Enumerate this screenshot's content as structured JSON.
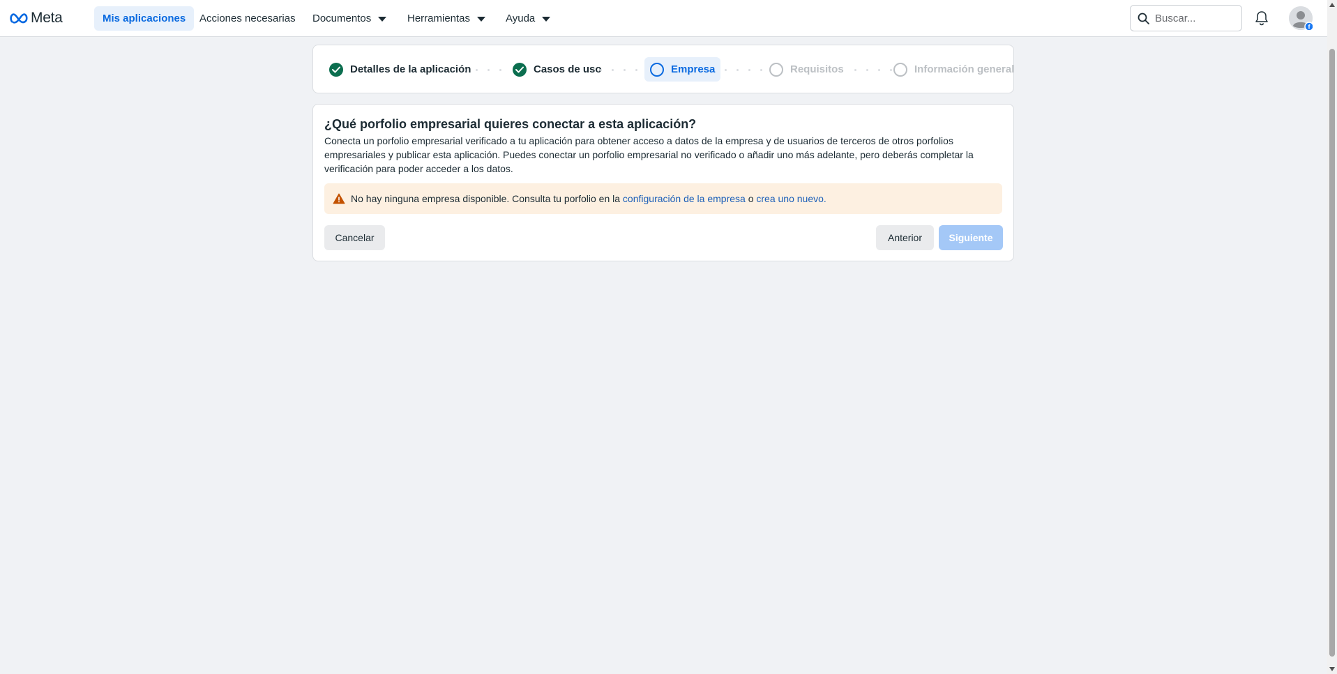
{
  "header": {
    "logo_text": "Meta",
    "nav": [
      {
        "label": "Mis aplicaciones",
        "active": true
      },
      {
        "label": "Acciones necesarias"
      },
      {
        "label": "Documentos",
        "dropdown": true
      },
      {
        "label": "Herramientas",
        "dropdown": true
      },
      {
        "label": "Ayuda",
        "dropdown": true
      }
    ],
    "search_placeholder": "Buscar..."
  },
  "stepper": {
    "steps": [
      {
        "label": "Detalles de la aplicación",
        "state": "done"
      },
      {
        "label": "Casos de uso",
        "state": "done"
      },
      {
        "label": "Empresa",
        "state": "current"
      },
      {
        "label": "Requisitos",
        "state": "future"
      },
      {
        "label": "Información general",
        "state": "future"
      }
    ]
  },
  "main": {
    "title": "¿Qué porfolio empresarial quieres conectar a esta aplicación?",
    "description": "Conecta un porfolio empresarial verificado a tu aplicación para obtener acceso a datos de la empresa y de usuarios de terceros de otros porfolios empresariales y publicar esta aplicación. Puedes conectar un porfolio empresarial no verificado o añadir uno más adelante, pero deberás completar la verificación para poder acceder a los datos.",
    "warning": {
      "text_before": "No hay ninguna empresa disponible. Consulta tu porfolio en la ",
      "link1": "configuración de la empresa",
      "text_mid": " o ",
      "link2": "crea uno nuevo."
    },
    "buttons": {
      "cancel": "Cancelar",
      "previous": "Anterior",
      "next": "Siguiente"
    }
  },
  "colors": {
    "accent": "#0a6ae0",
    "done_green": "#0b6e4f",
    "warning_bg": "#fdf0e1",
    "next_disabled": "#a4c8f7"
  },
  "icons": [
    "meta-logo-icon",
    "chevron-down-icon",
    "search-icon",
    "bell-icon",
    "avatar-icon",
    "check-icon",
    "warning-icon"
  ]
}
